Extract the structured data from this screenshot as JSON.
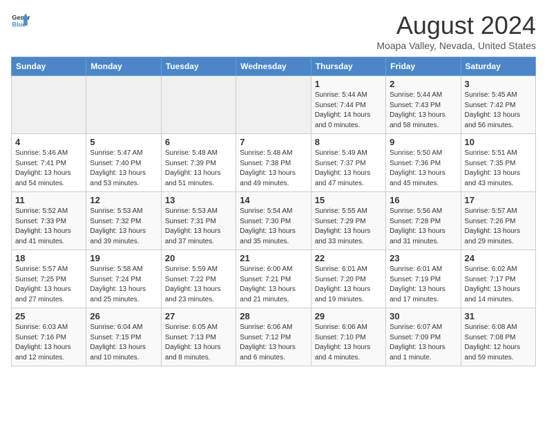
{
  "logo": {
    "text1": "General",
    "text2": "Blue"
  },
  "title": "August 2024",
  "location": "Moapa Valley, Nevada, United States",
  "days_of_week": [
    "Sunday",
    "Monday",
    "Tuesday",
    "Wednesday",
    "Thursday",
    "Friday",
    "Saturday"
  ],
  "weeks": [
    [
      {
        "day": "",
        "info": ""
      },
      {
        "day": "",
        "info": ""
      },
      {
        "day": "",
        "info": ""
      },
      {
        "day": "",
        "info": ""
      },
      {
        "day": "1",
        "info": "Sunrise: 5:44 AM\nSunset: 7:44 PM\nDaylight: 14 hours\nand 0 minutes."
      },
      {
        "day": "2",
        "info": "Sunrise: 5:44 AM\nSunset: 7:43 PM\nDaylight: 13 hours\nand 58 minutes."
      },
      {
        "day": "3",
        "info": "Sunrise: 5:45 AM\nSunset: 7:42 PM\nDaylight: 13 hours\nand 56 minutes."
      }
    ],
    [
      {
        "day": "4",
        "info": "Sunrise: 5:46 AM\nSunset: 7:41 PM\nDaylight: 13 hours\nand 54 minutes."
      },
      {
        "day": "5",
        "info": "Sunrise: 5:47 AM\nSunset: 7:40 PM\nDaylight: 13 hours\nand 53 minutes."
      },
      {
        "day": "6",
        "info": "Sunrise: 5:48 AM\nSunset: 7:39 PM\nDaylight: 13 hours\nand 51 minutes."
      },
      {
        "day": "7",
        "info": "Sunrise: 5:48 AM\nSunset: 7:38 PM\nDaylight: 13 hours\nand 49 minutes."
      },
      {
        "day": "8",
        "info": "Sunrise: 5:49 AM\nSunset: 7:37 PM\nDaylight: 13 hours\nand 47 minutes."
      },
      {
        "day": "9",
        "info": "Sunrise: 5:50 AM\nSunset: 7:36 PM\nDaylight: 13 hours\nand 45 minutes."
      },
      {
        "day": "10",
        "info": "Sunrise: 5:51 AM\nSunset: 7:35 PM\nDaylight: 13 hours\nand 43 minutes."
      }
    ],
    [
      {
        "day": "11",
        "info": "Sunrise: 5:52 AM\nSunset: 7:33 PM\nDaylight: 13 hours\nand 41 minutes."
      },
      {
        "day": "12",
        "info": "Sunrise: 5:53 AM\nSunset: 7:32 PM\nDaylight: 13 hours\nand 39 minutes."
      },
      {
        "day": "13",
        "info": "Sunrise: 5:53 AM\nSunset: 7:31 PM\nDaylight: 13 hours\nand 37 minutes."
      },
      {
        "day": "14",
        "info": "Sunrise: 5:54 AM\nSunset: 7:30 PM\nDaylight: 13 hours\nand 35 minutes."
      },
      {
        "day": "15",
        "info": "Sunrise: 5:55 AM\nSunset: 7:29 PM\nDaylight: 13 hours\nand 33 minutes."
      },
      {
        "day": "16",
        "info": "Sunrise: 5:56 AM\nSunset: 7:28 PM\nDaylight: 13 hours\nand 31 minutes."
      },
      {
        "day": "17",
        "info": "Sunrise: 5:57 AM\nSunset: 7:26 PM\nDaylight: 13 hours\nand 29 minutes."
      }
    ],
    [
      {
        "day": "18",
        "info": "Sunrise: 5:57 AM\nSunset: 7:25 PM\nDaylight: 13 hours\nand 27 minutes."
      },
      {
        "day": "19",
        "info": "Sunrise: 5:58 AM\nSunset: 7:24 PM\nDaylight: 13 hours\nand 25 minutes."
      },
      {
        "day": "20",
        "info": "Sunrise: 5:59 AM\nSunset: 7:22 PM\nDaylight: 13 hours\nand 23 minutes."
      },
      {
        "day": "21",
        "info": "Sunrise: 6:00 AM\nSunset: 7:21 PM\nDaylight: 13 hours\nand 21 minutes."
      },
      {
        "day": "22",
        "info": "Sunrise: 6:01 AM\nSunset: 7:20 PM\nDaylight: 13 hours\nand 19 minutes."
      },
      {
        "day": "23",
        "info": "Sunrise: 6:01 AM\nSunset: 7:19 PM\nDaylight: 13 hours\nand 17 minutes."
      },
      {
        "day": "24",
        "info": "Sunrise: 6:02 AM\nSunset: 7:17 PM\nDaylight: 13 hours\nand 14 minutes."
      }
    ],
    [
      {
        "day": "25",
        "info": "Sunrise: 6:03 AM\nSunset: 7:16 PM\nDaylight: 13 hours\nand 12 minutes."
      },
      {
        "day": "26",
        "info": "Sunrise: 6:04 AM\nSunset: 7:15 PM\nDaylight: 13 hours\nand 10 minutes."
      },
      {
        "day": "27",
        "info": "Sunrise: 6:05 AM\nSunset: 7:13 PM\nDaylight: 13 hours\nand 8 minutes."
      },
      {
        "day": "28",
        "info": "Sunrise: 6:06 AM\nSunset: 7:12 PM\nDaylight: 13 hours\nand 6 minutes."
      },
      {
        "day": "29",
        "info": "Sunrise: 6:06 AM\nSunset: 7:10 PM\nDaylight: 13 hours\nand 4 minutes."
      },
      {
        "day": "30",
        "info": "Sunrise: 6:07 AM\nSunset: 7:09 PM\nDaylight: 13 hours\nand 1 minute."
      },
      {
        "day": "31",
        "info": "Sunrise: 6:08 AM\nSunset: 7:08 PM\nDaylight: 12 hours\nand 59 minutes."
      }
    ]
  ]
}
